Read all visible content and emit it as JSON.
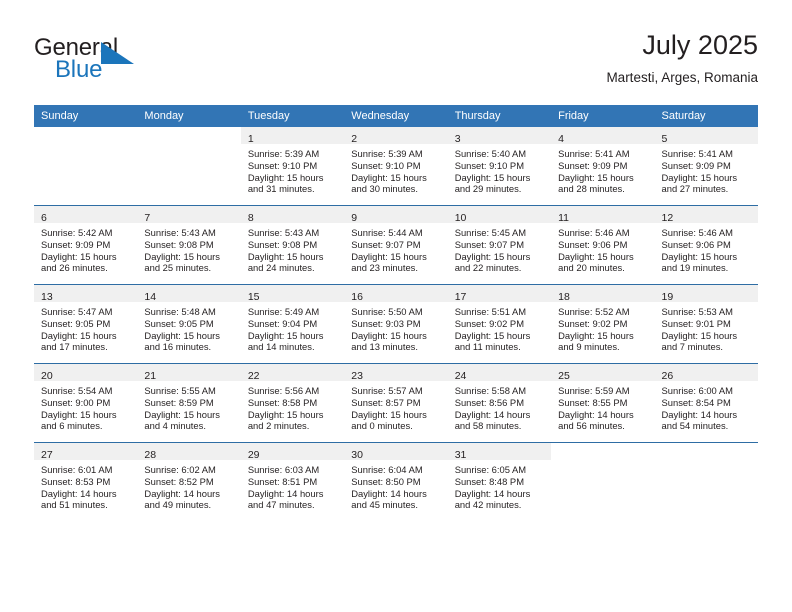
{
  "brand": {
    "name_part1": "General",
    "name_part2": "Blue",
    "triangle_icon": "triangle-icon",
    "accent_color": "#1b75bb"
  },
  "header": {
    "month_title": "July 2025",
    "location": "Martesti, Arges, Romania"
  },
  "theme": {
    "header_blue": "#3275b5",
    "row_divider_blue": "#2e6da4",
    "day_band_gray": "#f0f0f0",
    "text_color": "#231f20"
  },
  "calendar": {
    "weekday_headers": [
      "Sunday",
      "Monday",
      "Tuesday",
      "Wednesday",
      "Thursday",
      "Friday",
      "Saturday"
    ],
    "weeks": [
      [
        {
          "day": "",
          "lines": []
        },
        {
          "day": "",
          "lines": []
        },
        {
          "day": "1",
          "lines": [
            "Sunrise: 5:39 AM",
            "Sunset: 9:10 PM",
            "Daylight: 15 hours and 31 minutes."
          ]
        },
        {
          "day": "2",
          "lines": [
            "Sunrise: 5:39 AM",
            "Sunset: 9:10 PM",
            "Daylight: 15 hours and 30 minutes."
          ]
        },
        {
          "day": "3",
          "lines": [
            "Sunrise: 5:40 AM",
            "Sunset: 9:10 PM",
            "Daylight: 15 hours and 29 minutes."
          ]
        },
        {
          "day": "4",
          "lines": [
            "Sunrise: 5:41 AM",
            "Sunset: 9:09 PM",
            "Daylight: 15 hours and 28 minutes."
          ]
        },
        {
          "day": "5",
          "lines": [
            "Sunrise: 5:41 AM",
            "Sunset: 9:09 PM",
            "Daylight: 15 hours and 27 minutes."
          ]
        }
      ],
      [
        {
          "day": "6",
          "lines": [
            "Sunrise: 5:42 AM",
            "Sunset: 9:09 PM",
            "Daylight: 15 hours and 26 minutes."
          ]
        },
        {
          "day": "7",
          "lines": [
            "Sunrise: 5:43 AM",
            "Sunset: 9:08 PM",
            "Daylight: 15 hours and 25 minutes."
          ]
        },
        {
          "day": "8",
          "lines": [
            "Sunrise: 5:43 AM",
            "Sunset: 9:08 PM",
            "Daylight: 15 hours and 24 minutes."
          ]
        },
        {
          "day": "9",
          "lines": [
            "Sunrise: 5:44 AM",
            "Sunset: 9:07 PM",
            "Daylight: 15 hours and 23 minutes."
          ]
        },
        {
          "day": "10",
          "lines": [
            "Sunrise: 5:45 AM",
            "Sunset: 9:07 PM",
            "Daylight: 15 hours and 22 minutes."
          ]
        },
        {
          "day": "11",
          "lines": [
            "Sunrise: 5:46 AM",
            "Sunset: 9:06 PM",
            "Daylight: 15 hours and 20 minutes."
          ]
        },
        {
          "day": "12",
          "lines": [
            "Sunrise: 5:46 AM",
            "Sunset: 9:06 PM",
            "Daylight: 15 hours and 19 minutes."
          ]
        }
      ],
      [
        {
          "day": "13",
          "lines": [
            "Sunrise: 5:47 AM",
            "Sunset: 9:05 PM",
            "Daylight: 15 hours and 17 minutes."
          ]
        },
        {
          "day": "14",
          "lines": [
            "Sunrise: 5:48 AM",
            "Sunset: 9:05 PM",
            "Daylight: 15 hours and 16 minutes."
          ]
        },
        {
          "day": "15",
          "lines": [
            "Sunrise: 5:49 AM",
            "Sunset: 9:04 PM",
            "Daylight: 15 hours and 14 minutes."
          ]
        },
        {
          "day": "16",
          "lines": [
            "Sunrise: 5:50 AM",
            "Sunset: 9:03 PM",
            "Daylight: 15 hours and 13 minutes."
          ]
        },
        {
          "day": "17",
          "lines": [
            "Sunrise: 5:51 AM",
            "Sunset: 9:02 PM",
            "Daylight: 15 hours and 11 minutes."
          ]
        },
        {
          "day": "18",
          "lines": [
            "Sunrise: 5:52 AM",
            "Sunset: 9:02 PM",
            "Daylight: 15 hours and 9 minutes."
          ]
        },
        {
          "day": "19",
          "lines": [
            "Sunrise: 5:53 AM",
            "Sunset: 9:01 PM",
            "Daylight: 15 hours and 7 minutes."
          ]
        }
      ],
      [
        {
          "day": "20",
          "lines": [
            "Sunrise: 5:54 AM",
            "Sunset: 9:00 PM",
            "Daylight: 15 hours and 6 minutes."
          ]
        },
        {
          "day": "21",
          "lines": [
            "Sunrise: 5:55 AM",
            "Sunset: 8:59 PM",
            "Daylight: 15 hours and 4 minutes."
          ]
        },
        {
          "day": "22",
          "lines": [
            "Sunrise: 5:56 AM",
            "Sunset: 8:58 PM",
            "Daylight: 15 hours and 2 minutes."
          ]
        },
        {
          "day": "23",
          "lines": [
            "Sunrise: 5:57 AM",
            "Sunset: 8:57 PM",
            "Daylight: 15 hours and 0 minutes."
          ]
        },
        {
          "day": "24",
          "lines": [
            "Sunrise: 5:58 AM",
            "Sunset: 8:56 PM",
            "Daylight: 14 hours and 58 minutes."
          ]
        },
        {
          "day": "25",
          "lines": [
            "Sunrise: 5:59 AM",
            "Sunset: 8:55 PM",
            "Daylight: 14 hours and 56 minutes."
          ]
        },
        {
          "day": "26",
          "lines": [
            "Sunrise: 6:00 AM",
            "Sunset: 8:54 PM",
            "Daylight: 14 hours and 54 minutes."
          ]
        }
      ],
      [
        {
          "day": "27",
          "lines": [
            "Sunrise: 6:01 AM",
            "Sunset: 8:53 PM",
            "Daylight: 14 hours and 51 minutes."
          ]
        },
        {
          "day": "28",
          "lines": [
            "Sunrise: 6:02 AM",
            "Sunset: 8:52 PM",
            "Daylight: 14 hours and 49 minutes."
          ]
        },
        {
          "day": "29",
          "lines": [
            "Sunrise: 6:03 AM",
            "Sunset: 8:51 PM",
            "Daylight: 14 hours and 47 minutes."
          ]
        },
        {
          "day": "30",
          "lines": [
            "Sunrise: 6:04 AM",
            "Sunset: 8:50 PM",
            "Daylight: 14 hours and 45 minutes."
          ]
        },
        {
          "day": "31",
          "lines": [
            "Sunrise: 6:05 AM",
            "Sunset: 8:48 PM",
            "Daylight: 14 hours and 42 minutes."
          ]
        },
        {
          "day": "",
          "lines": []
        },
        {
          "day": "",
          "lines": []
        }
      ]
    ]
  }
}
